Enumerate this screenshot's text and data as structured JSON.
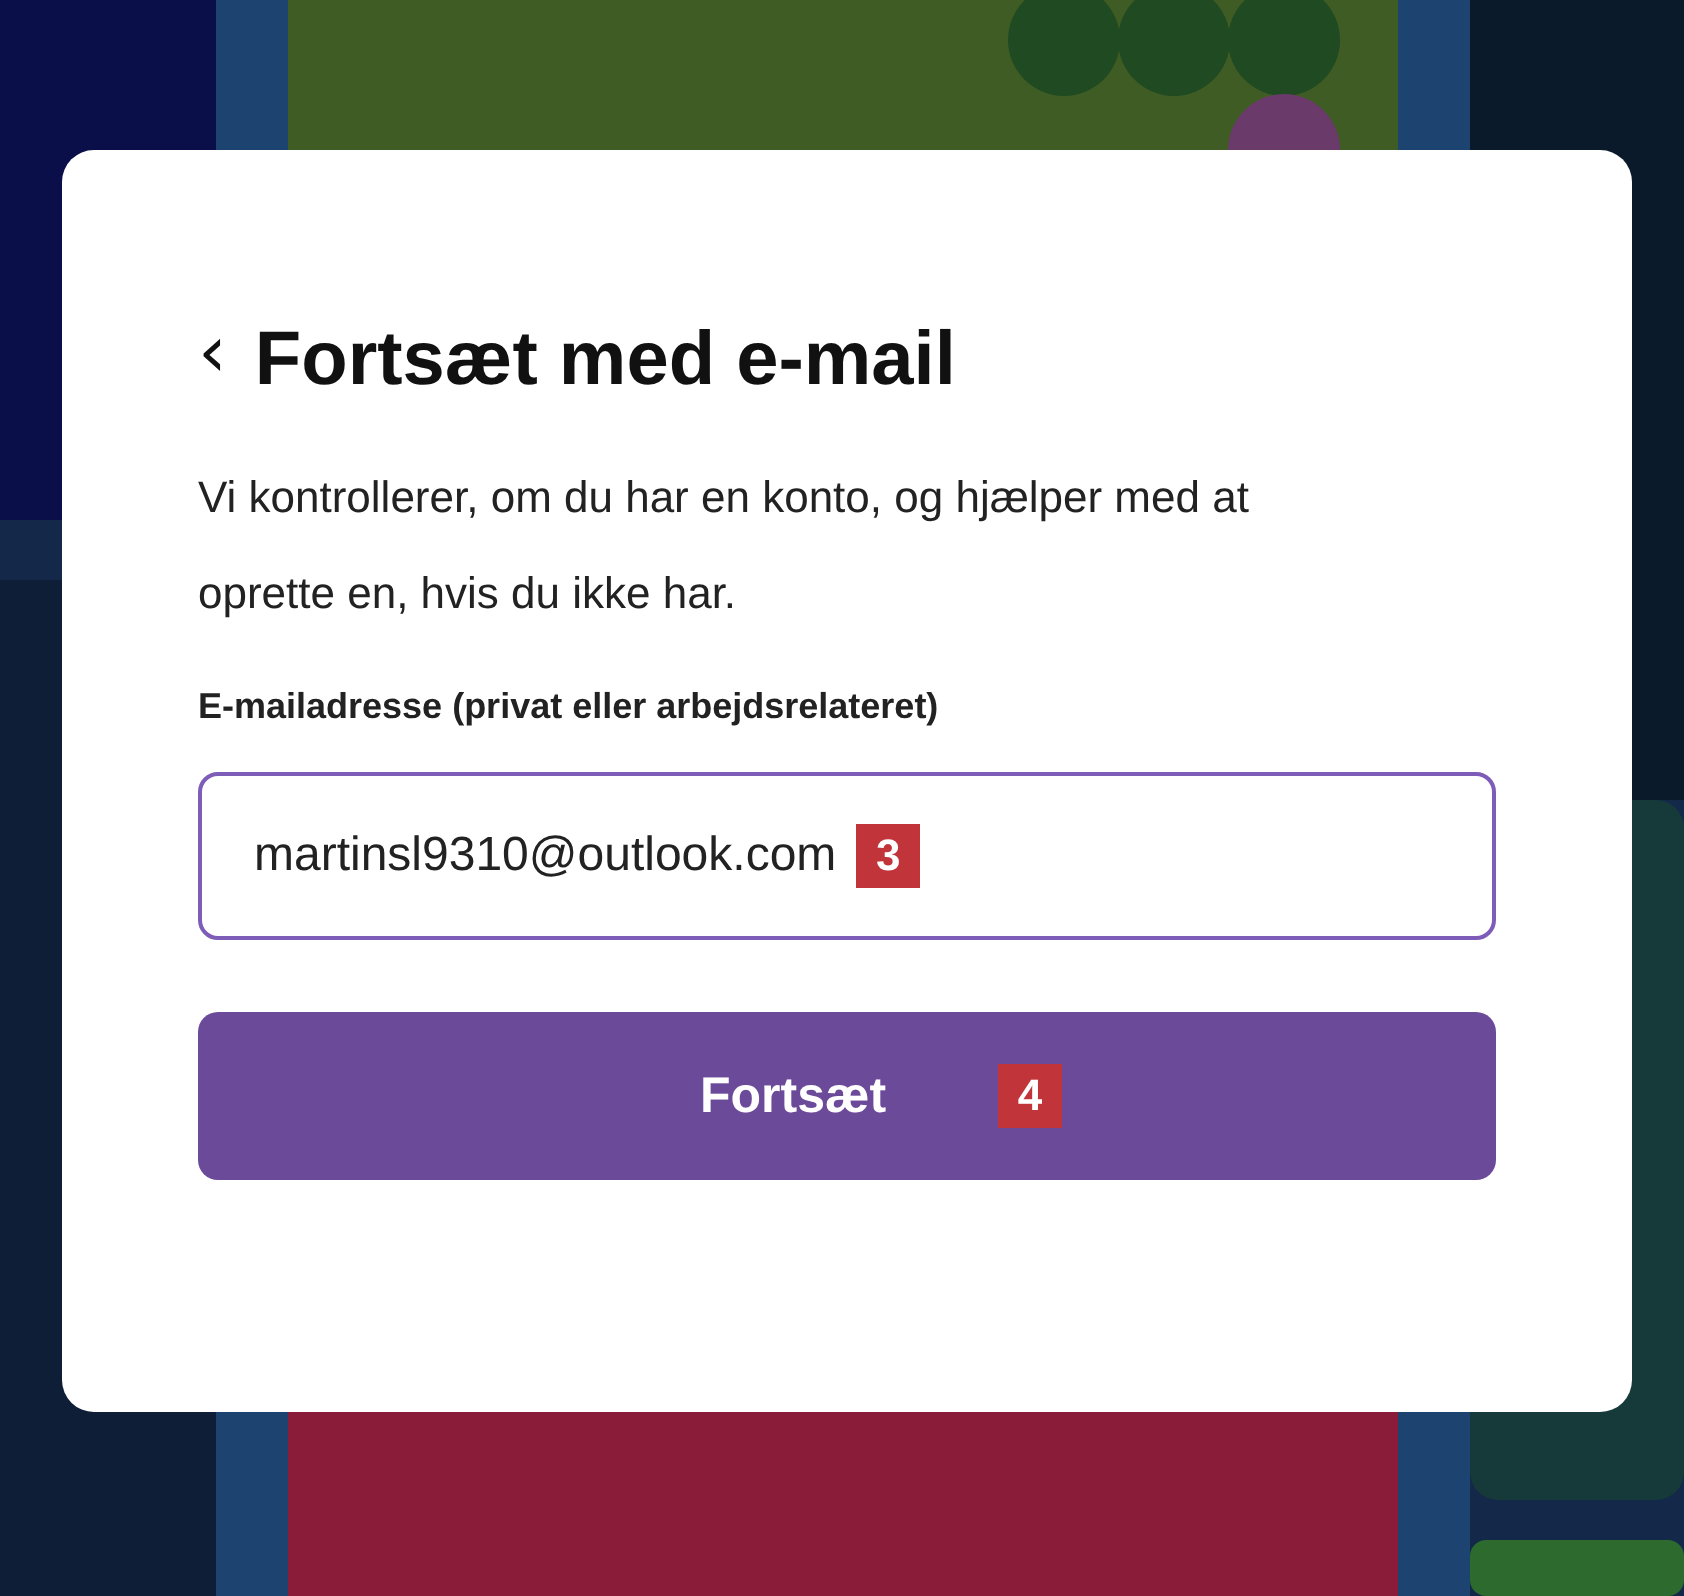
{
  "dialog": {
    "back_icon": "‹",
    "title": "Fortsæt med e-mail",
    "description": "Vi kontrollerer, om du har en konto, og hjælper med at oprette en, hvis du ikke har.",
    "email_label": "E-mailadresse (privat eller arbejdsrelateret)",
    "email_value": "martinsl9310@outlook.com",
    "email_badge": "3",
    "continue_button": "Fortsæt",
    "continue_badge": "4"
  }
}
